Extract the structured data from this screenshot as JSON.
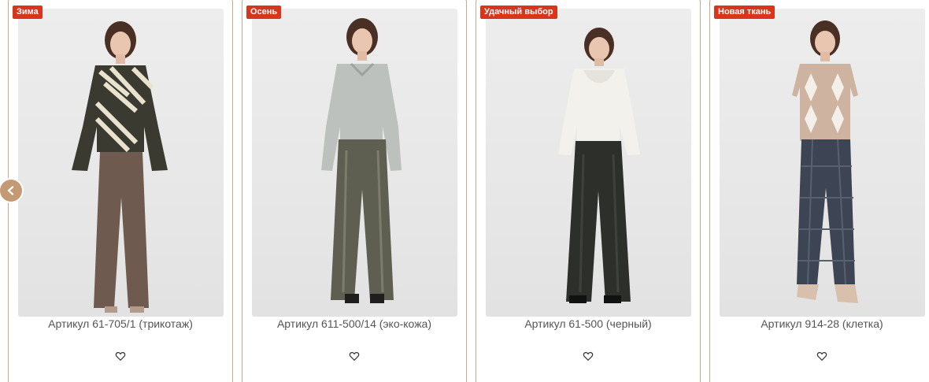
{
  "carousel": {
    "prev_icon": "chevron-left-icon",
    "accent_color": "#c39a74",
    "badge_color": "#d9341c",
    "items": [
      {
        "badge": "Зима",
        "title": "Артикул 61-705/1 (трикотаж)",
        "fav_icon": "heart-outline-icon"
      },
      {
        "badge": "Осень",
        "title": "Артикул 611-500/14 (эко-кожа)",
        "fav_icon": "heart-outline-icon"
      },
      {
        "badge": "Удачный выбор",
        "title": "Артикул 61-500 (черный)",
        "fav_icon": "heart-outline-icon"
      },
      {
        "badge": "Новая ткань",
        "title": "Артикул 914-28 (клетка)",
        "fav_icon": "heart-outline-icon"
      }
    ]
  }
}
